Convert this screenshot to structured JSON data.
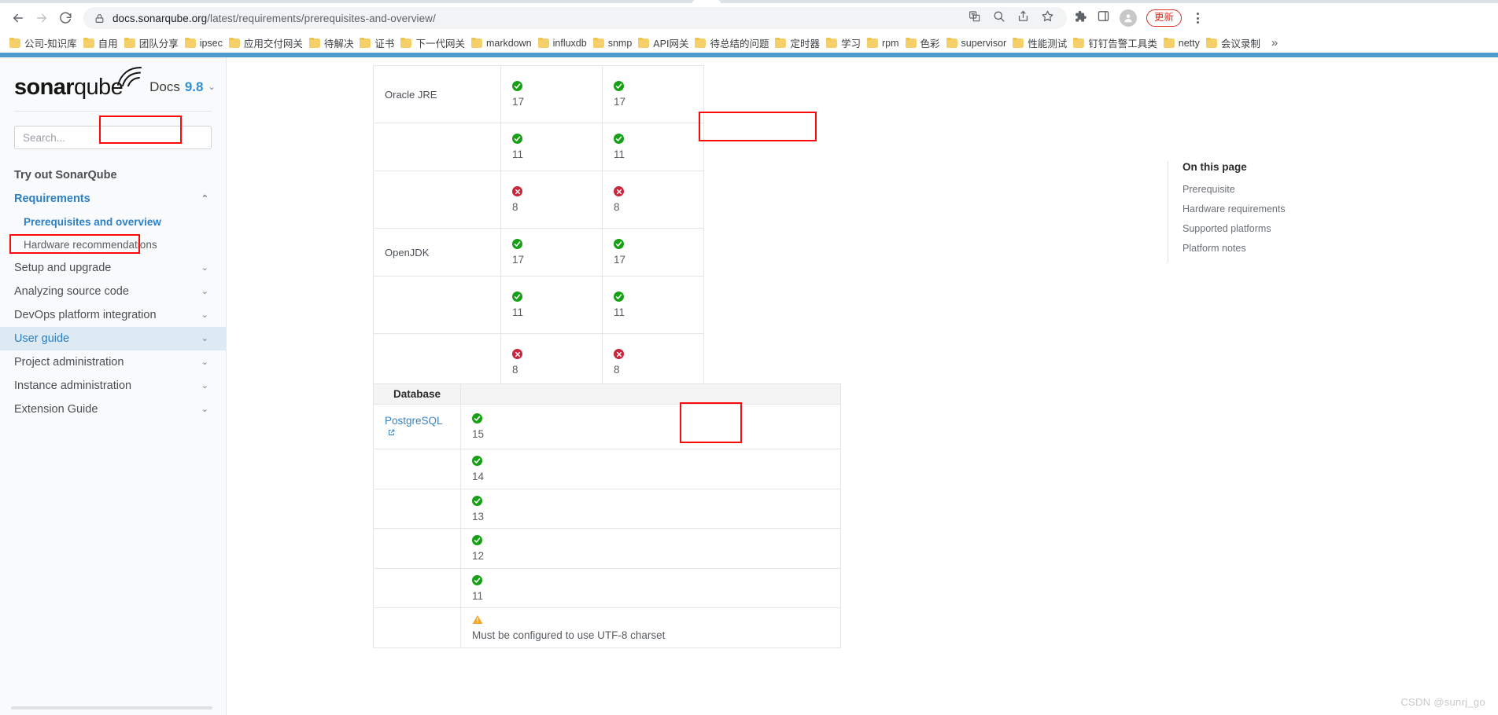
{
  "browser": {
    "back_label": "back-arrow",
    "forward_label": "forward-arrow",
    "reload_label": "reload",
    "url_domain": "docs.sonarqube.org",
    "url_path": "/latest/requirements/prerequisites-and-overview/",
    "url_full": "docs.sonarqube.org/latest/requirements/prerequisites-and-overview/",
    "update_button": "更新",
    "bookmarks": [
      "公司-知识库",
      "自用",
      "团队分享",
      "ipsec",
      "应用交付网关",
      "待解决",
      "证书",
      "下一代网关",
      "markdown",
      "influxdb",
      "snmp",
      "API网关",
      "待总结的问题",
      "定时器",
      "学习",
      "rpm",
      "色彩",
      "supervisor",
      "性能测试",
      "钉钉告警工具类",
      "netty",
      "会议录制"
    ],
    "bookmarks_overflow": "»"
  },
  "sidebar": {
    "logo_bold": "sonar",
    "logo_light": "qube",
    "docs_label": "Docs",
    "docs_version": "9.8",
    "search_placeholder": "Search...",
    "items": [
      {
        "label": "Try out SonarQube",
        "style": "bold",
        "chevron": ""
      },
      {
        "label": "Requirements",
        "style": "accent",
        "chevron": "⌃"
      },
      {
        "label": "Prerequisites and overview",
        "style": "sub-current",
        "chevron": ""
      },
      {
        "label": "Hardware recommendations",
        "style": "sub",
        "chevron": ""
      },
      {
        "label": "Setup and upgrade",
        "style": "normal",
        "chevron": "⌄"
      },
      {
        "label": "Analyzing source code",
        "style": "normal",
        "chevron": "⌄"
      },
      {
        "label": "DevOps platform integration",
        "style": "normal",
        "chevron": "⌄"
      },
      {
        "label": "User guide",
        "style": "active",
        "chevron": "⌄"
      },
      {
        "label": "Project administration",
        "style": "normal",
        "chevron": "⌄"
      },
      {
        "label": "Instance administration",
        "style": "normal",
        "chevron": "⌄"
      },
      {
        "label": "Extension Guide",
        "style": "normal",
        "chevron": "⌄"
      }
    ]
  },
  "content": {
    "java_table": {
      "rows": [
        {
          "name": "Oracle JRE",
          "cells": [
            {
              "status": "ok",
              "version": "17"
            },
            {
              "status": "ok",
              "version": "17"
            }
          ],
          "tall": true
        },
        {
          "name": "",
          "cells": [
            {
              "status": "ok",
              "version": "11"
            },
            {
              "status": "ok",
              "version": "11"
            }
          ],
          "tall": false
        },
        {
          "name": "",
          "cells": [
            {
              "status": "no",
              "version": "8"
            },
            {
              "status": "no",
              "version": "8"
            }
          ],
          "tall": true
        },
        {
          "name": "OpenJDK",
          "cells": [
            {
              "status": "ok",
              "version": "17"
            },
            {
              "status": "ok",
              "version": "17"
            }
          ],
          "tall": false
        },
        {
          "name": "",
          "cells": [
            {
              "status": "ok",
              "version": "11"
            },
            {
              "status": "ok",
              "version": "11"
            }
          ],
          "tall": true
        },
        {
          "name": "",
          "cells": [
            {
              "status": "no",
              "version": "8"
            },
            {
              "status": "no",
              "version": "8"
            }
          ],
          "tall": true
        }
      ]
    },
    "db_table": {
      "header": "Database",
      "header_blank": "",
      "rows": [
        {
          "name": "PostgreSQL",
          "is_link": true,
          "status": "ok",
          "version": "15",
          "note": ""
        },
        {
          "name": "",
          "is_link": false,
          "status": "ok",
          "version": "14",
          "note": ""
        },
        {
          "name": "",
          "is_link": false,
          "status": "ok",
          "version": "13",
          "note": ""
        },
        {
          "name": "",
          "is_link": false,
          "status": "ok",
          "version": "12",
          "note": ""
        },
        {
          "name": "",
          "is_link": false,
          "status": "ok",
          "version": "11",
          "note": ""
        },
        {
          "name": "",
          "is_link": false,
          "status": "warn",
          "version": "",
          "note": "Must be configured to use UTF-8 charset"
        }
      ]
    }
  },
  "on_this_page": {
    "title": "On this page",
    "links": [
      "Prerequisite",
      "Hardware requirements",
      "Supported platforms",
      "Platform notes"
    ]
  },
  "watermark": "CSDN @sunrj_go",
  "colors": {
    "accent_blue": "#2b7fc4",
    "top_bar_blue": "#4e9bcd",
    "ok_green": "#16a016",
    "fail_red": "#c9253c",
    "warn_orange": "#f5a623",
    "annotation_red": "#fa0a0a"
  }
}
